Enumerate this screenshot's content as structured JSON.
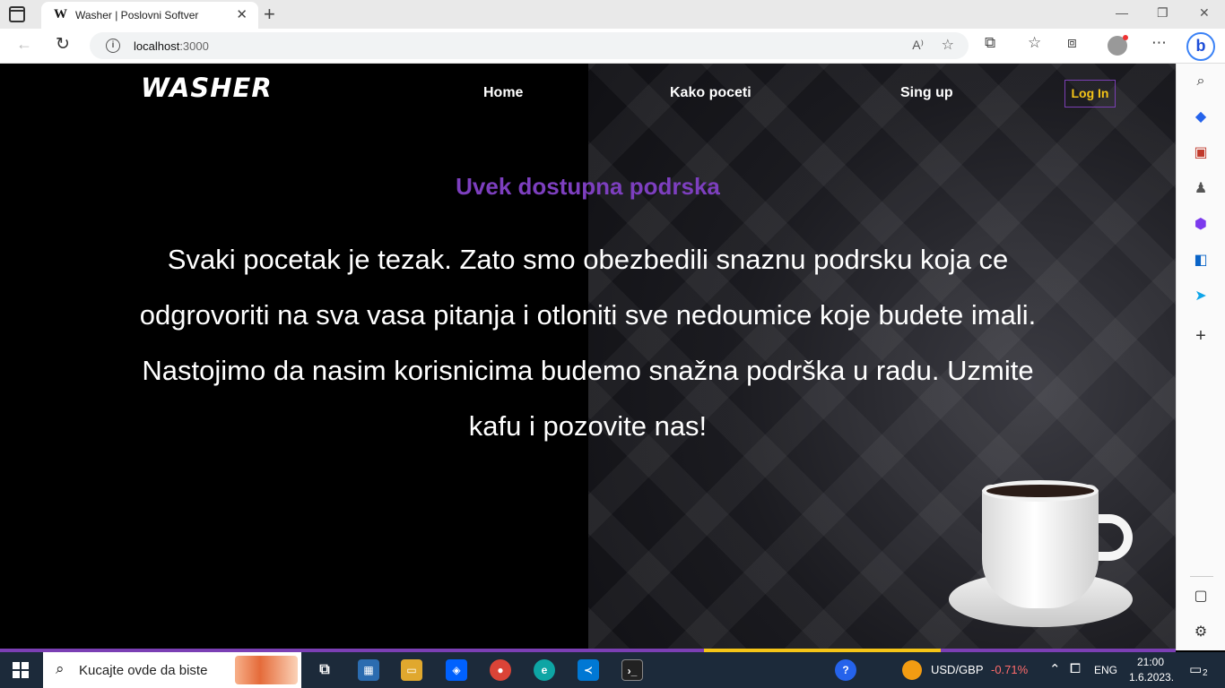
{
  "browser": {
    "tab_favicon": "W",
    "tab_title": "Washer | Poslovni Softver",
    "url_host": "localhost",
    "url_port": ":3000",
    "read_aloud_label": "Ȃ"
  },
  "site": {
    "brand": "WASHER",
    "nav": {
      "home": "Home",
      "how_to_start": "Kako poceti",
      "sign_up": "Sing up",
      "login": "Log In"
    },
    "headline": "Uvek dostupna podrska",
    "body": "Svaki pocetak je tezak. Zato smo obezbedili snaznu podrsku koja ce odgrovoriti na sva vasa pitanja i otloniti sve nedoumice koje budete imali. Nastojimo da nasim korisnicima budemo snažna podrška u radu. Uzmite kafu i pozovite nas!"
  },
  "colors": {
    "accent_purple": "#7d3fbf",
    "login_yellow": "#f5c518",
    "scroll_progress_yellow": "#f5c518"
  },
  "taskbar": {
    "search_text": "Kucajte ovde da biste",
    "ticker_label": "USD/GBP",
    "ticker_value": "-0.71%",
    "language": "ENG",
    "time": "21:00",
    "date": "1.6.2023.",
    "notifications": "2",
    "apps": [
      "task-view",
      "store",
      "file-explorer",
      "dropbox",
      "chrome",
      "edge",
      "vscode",
      "terminal"
    ]
  },
  "icons": {
    "edge_sidebar": [
      "search-icon",
      "tag-icon",
      "briefcase-icon",
      "chess-icon",
      "office-icon",
      "outlook-icon",
      "send-icon",
      "plus-icon",
      "split-screen-icon",
      "settings-icon"
    ]
  }
}
